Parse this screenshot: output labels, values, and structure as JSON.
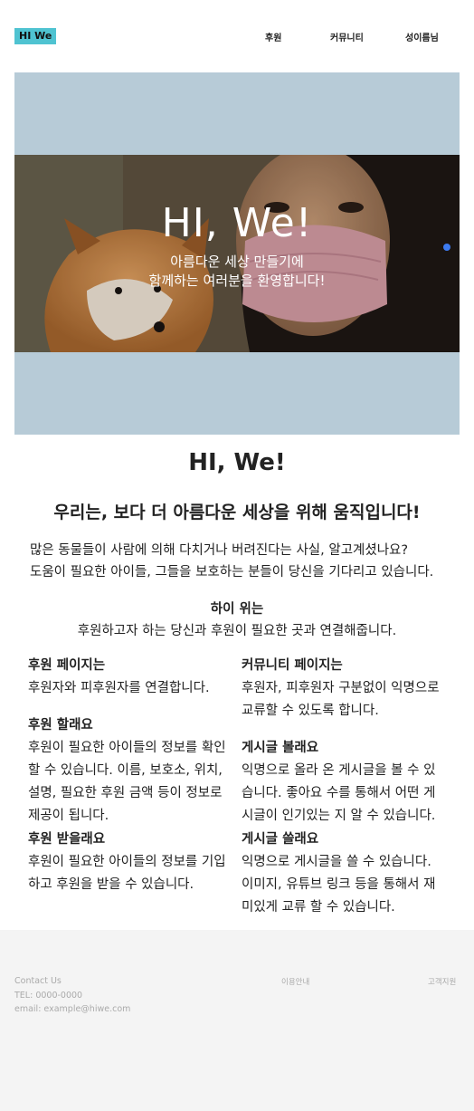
{
  "nav": {
    "logo": "HI We",
    "links": [
      "후원",
      "커뮤니티",
      "성이름님"
    ]
  },
  "hero": {
    "title": "HI, We!",
    "subtitle_line1": "아름다운 세상 만들기에",
    "subtitle_line2": "함께하는 여러분을 환영합니다!",
    "background_color": "#b7cbd7",
    "indicator_color": "#3d7bf0"
  },
  "main": {
    "heading": "HI, We!",
    "subheading": "우리는, 보다 더 아름다운 세상을 위해 움직입니다!",
    "intro_line1": "많은 동물들이 사람에 의해 다치거나 버려진다는 사실, 알고계셨나요?",
    "intro_line2": "도움이 필요한 아이들, 그들을 보호하는 분들이 당신을 기다리고 있습니다.",
    "about_title": "하이 위는",
    "about_text": "후원하고자 하는 당신과 후원이 필요한 곳과 연결해줍니다.",
    "left": [
      {
        "title": "후원 페이지는",
        "body": [
          "후원자와 피후원자를 연결합니다."
        ]
      },
      {
        "title": "후원 할래요",
        "body": [
          "후원이 필요한 아이들의 정보를 확인",
          "할 수 있습니다. 이름, 보호소, 위치,",
          "설명, 필요한 후원 금액 등이 정보로",
          "제공이 됩니다."
        ]
      },
      {
        "title": "후원 받을래요",
        "body": [
          "후원이 필요한 아이들의 정보를 기입",
          "하고 후원을 받을 수 있습니다."
        ]
      }
    ],
    "right": [
      {
        "title": "커뮤니티 페이지는",
        "body": [
          "후원자, 피후원자 구분없이 익명으로",
          "교류할 수 있도록 합니다."
        ]
      },
      {
        "title": "게시글 볼래요",
        "body": [
          "익명으로 올라 온 게시글을 볼 수 있",
          "습니다. 좋아요 수를 통해서 어떤 게",
          "시글이 인기있는 지 알 수 있습니다."
        ]
      },
      {
        "title": "게시글 쓸래요",
        "body": [
          "익명으로 게시글을 쓸 수 있습니다.",
          "이미지, 유튜브 링크 등을 통해서 재",
          "미있게 교류 할 수 있습니다."
        ]
      }
    ]
  },
  "footer": {
    "contact_title": "Contact Us",
    "tel": "TEL: 0000-0000",
    "email": "email: example@hiwe.com",
    "link_usage": "이용안내",
    "link_support": "고객지원",
    "background_color": "#f4f4f4"
  },
  "icons": [
    "carousel-indicator-dot"
  ]
}
